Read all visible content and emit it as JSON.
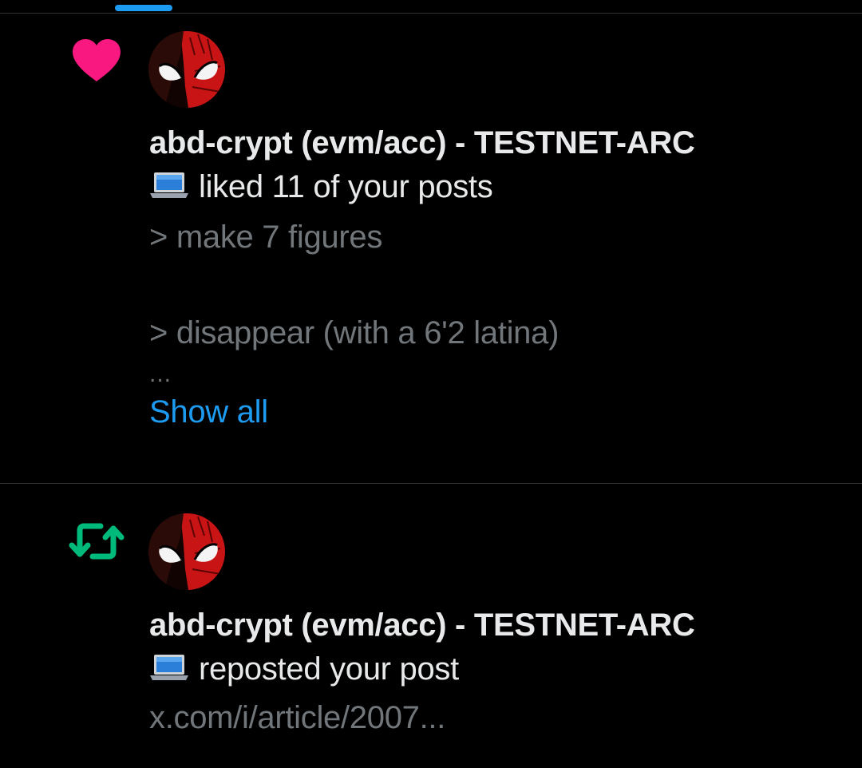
{
  "colors": {
    "background": "#000000",
    "text_primary": "#e7e9ea",
    "text_secondary": "#71767b",
    "accent_blue": "#1d9bf0",
    "like_pink": "#f91880",
    "repost_green": "#00ba7c",
    "divider": "#2f3336"
  },
  "notifications": [
    {
      "type": "like",
      "icon": "heart-icon",
      "avatar_icon": "spiderman-avatar",
      "actor_name": "abd-crypt (evm/acc) - TESTNET-ARC",
      "actor_emoji": "laptop-emoji",
      "action_text": "liked 11 of your posts",
      "quote_lines": [
        "> make 7 figures",
        "> disappear (with a 6'2 latina)"
      ],
      "ellipsis": "...",
      "show_all_label": "Show all"
    },
    {
      "type": "repost",
      "icon": "repost-icon",
      "avatar_icon": "spiderman-avatar",
      "actor_name": "abd-crypt (evm/acc) - TESTNET-ARC",
      "actor_emoji": "laptop-emoji",
      "action_text": "reposted your post",
      "link_text": "x.com/i/article/2007..."
    }
  ]
}
